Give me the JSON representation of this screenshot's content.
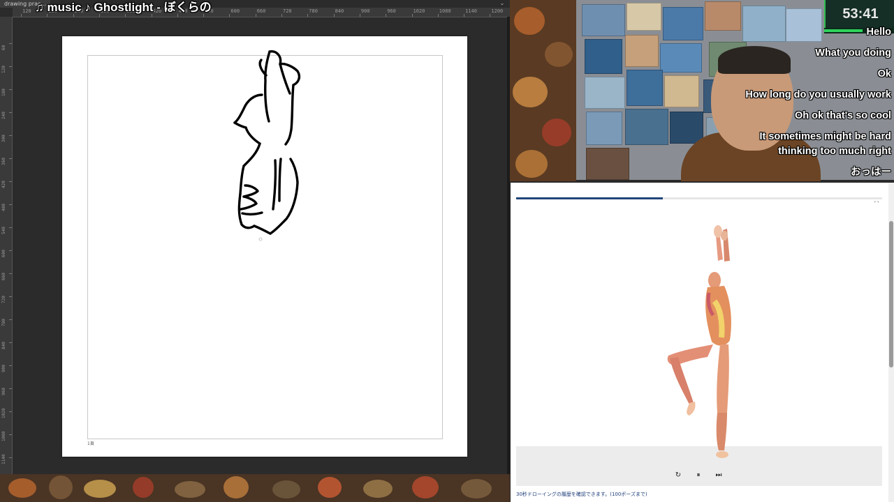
{
  "app": {
    "document_tab": "drawing prac...",
    "collapse_glyph": "⌄",
    "ruler_top_labels": [
      "120",
      "180",
      "240",
      "300",
      "360",
      "420",
      "480",
      "540",
      "600",
      "660",
      "720",
      "780",
      "840",
      "900",
      "960",
      "1020",
      "1080",
      "1140",
      "1200"
    ],
    "ruler_left_labels": [
      "60",
      "120",
      "180",
      "240",
      "300",
      "360",
      "420",
      "480",
      "540",
      "600",
      "660",
      "720",
      "780",
      "840",
      "900",
      "960",
      "1020",
      "1080",
      "1140"
    ],
    "page_number": "1頁"
  },
  "overlay": {
    "music_title": "♫ music ♪ Ghostlight - ぼくらの"
  },
  "timer": {
    "value": "53:41",
    "progress_fraction": 0.55
  },
  "chat": {
    "messages": [
      "Hello",
      "What you doing",
      "Ok",
      "How long do you usually work",
      "Oh ok that's so cool",
      "It sometimes might be hard",
      "thinking too much right",
      "おっはー"
    ]
  },
  "pose_viewer": {
    "progress_fraction": 0.4,
    "fullscreen_glyph": "⛶",
    "controls": {
      "reload": "↻",
      "pause": "⏸",
      "next": "⏭"
    },
    "caption": "30秒ドローイングの履歴を確認できます。(100ポーズまで)"
  },
  "colors": {
    "panel_accent": "#21457a",
    "timer_green": "#2fd35a",
    "timer_bg": "#152f26"
  }
}
